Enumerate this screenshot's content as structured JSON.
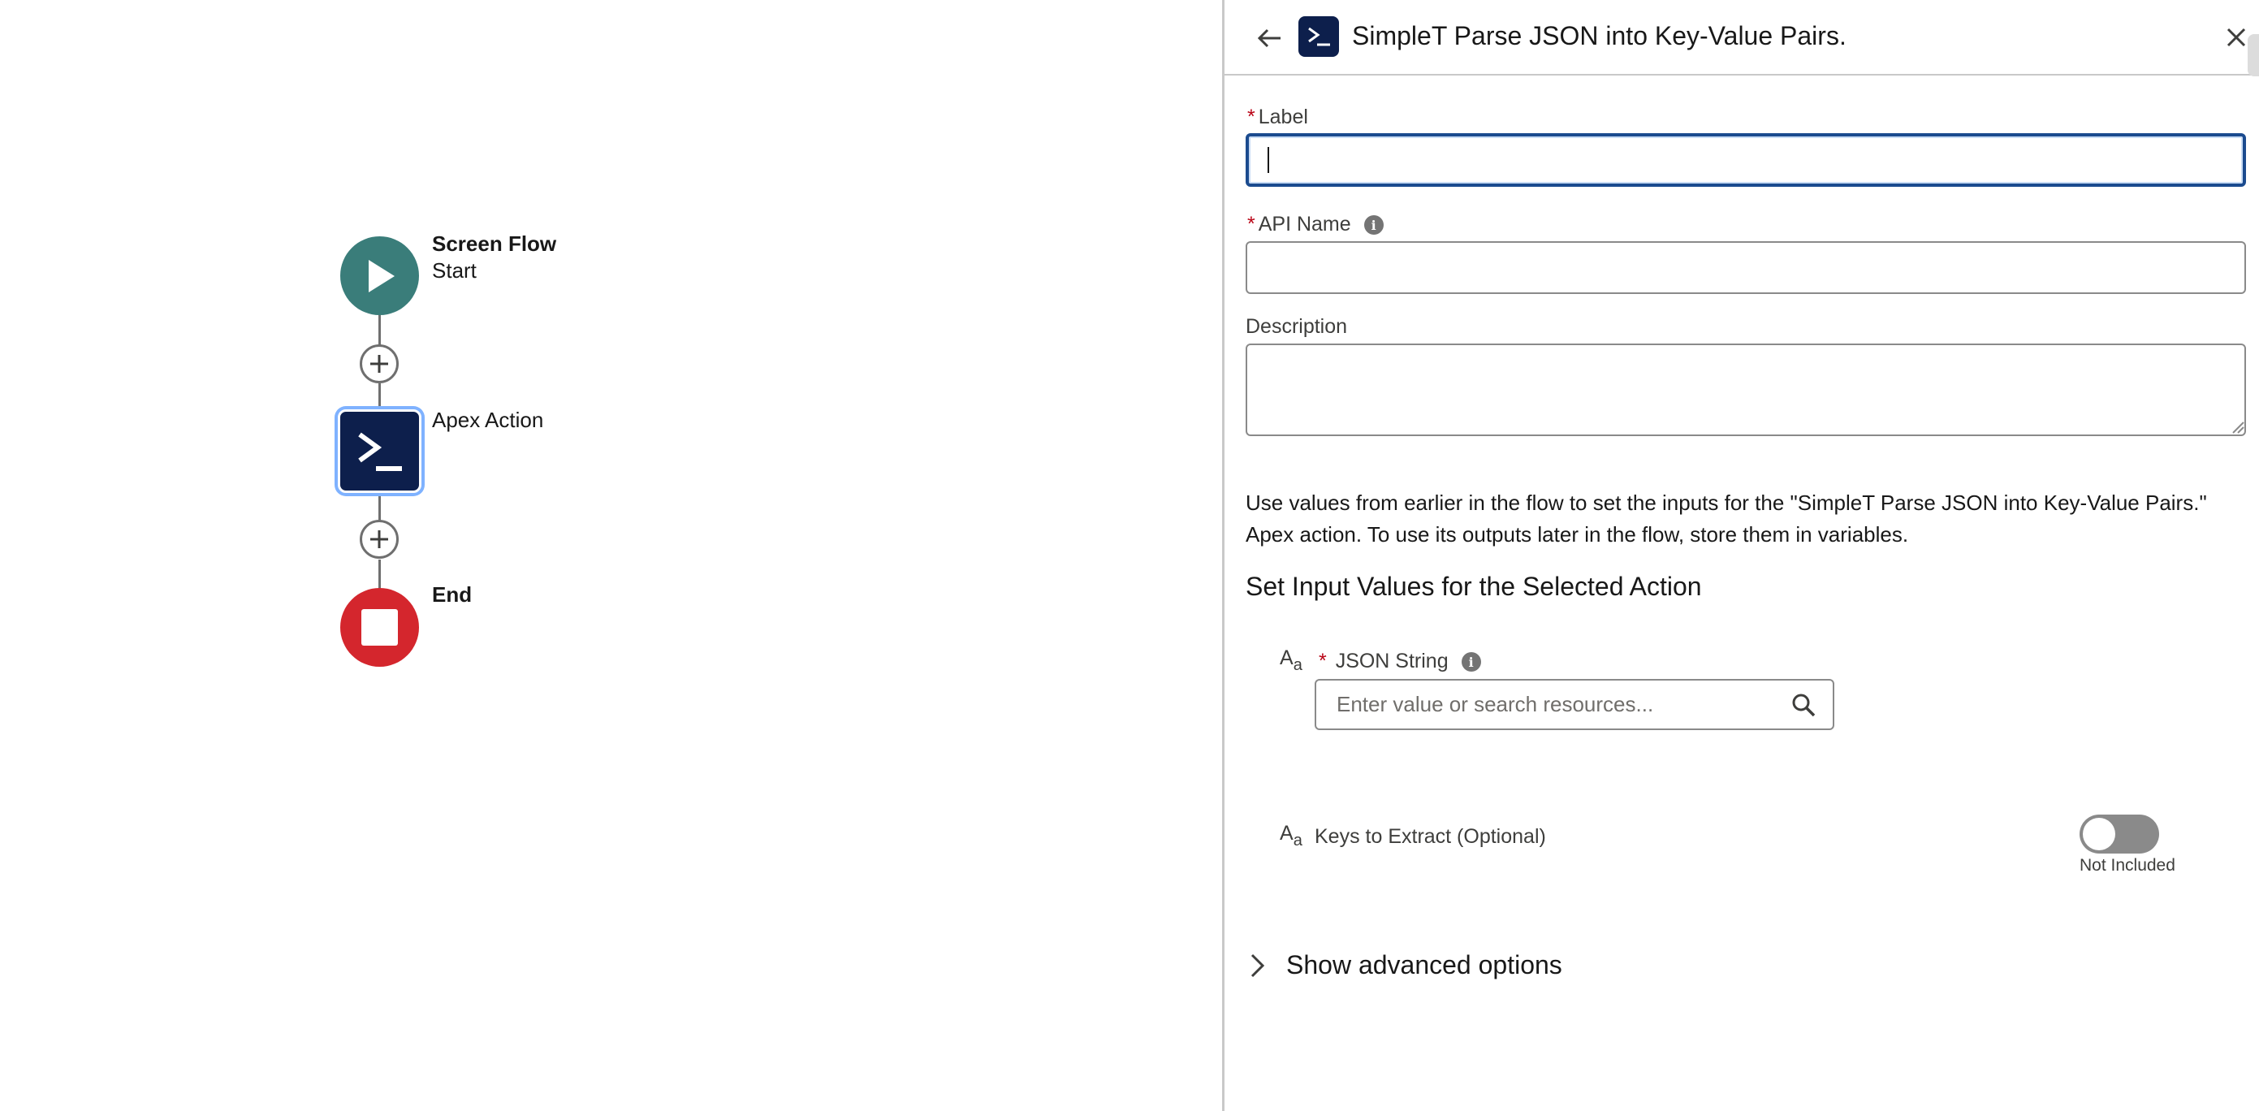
{
  "canvas": {
    "start_node": {
      "title": "Screen Flow",
      "subtitle": "Start"
    },
    "apex_node": {
      "label": "Apex Action"
    },
    "end_node": {
      "title": "End"
    }
  },
  "panel": {
    "title": "SimpleT Parse JSON into Key-Value Pairs.",
    "header_icon": "apex-action-icon",
    "label_field": {
      "label": "Label",
      "required_marker": "*",
      "value": ""
    },
    "api_name_field": {
      "label": "API Name",
      "required_marker": "*",
      "value": ""
    },
    "description_field": {
      "label": "Description",
      "value": ""
    },
    "help_text": "Use values from earlier in the flow to set the inputs for the \"SimpleT Parse JSON into Key-Value Pairs.\" Apex action. To use its outputs later in the flow, store them in variables.",
    "section_heading": "Set Input Values for the Selected Action",
    "json_string_input": {
      "type_icon_big": "A",
      "type_icon_small": "a",
      "label": "JSON String",
      "required_marker": "*",
      "placeholder": "Enter value or search resources..."
    },
    "keys_input": {
      "type_icon_big": "A",
      "type_icon_small": "a",
      "label": "Keys to Extract (Optional)",
      "toggle_status": "Not Included",
      "toggle_on": false
    },
    "advanced_options_label": "Show advanced options"
  },
  "colors": {
    "start": "#3a7d7a",
    "apex": "#0d1f4c",
    "end": "#d4262d",
    "focus_border": "#1b4b8f",
    "required": "#ba0517"
  }
}
